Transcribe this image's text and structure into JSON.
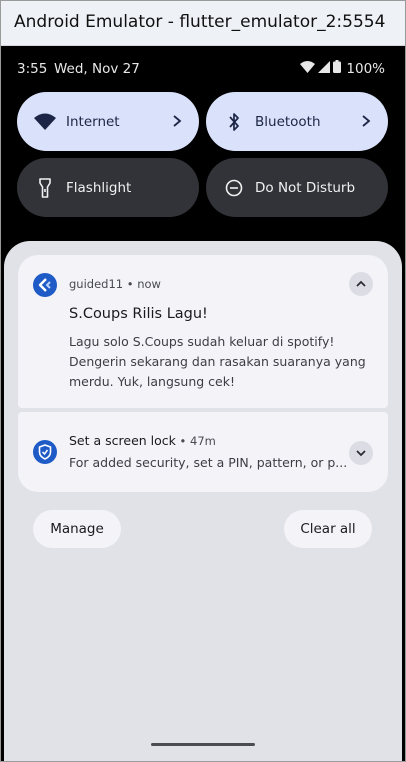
{
  "window": {
    "title": "Android Emulator - flutter_emulator_2:5554"
  },
  "status_bar": {
    "time": "3:55",
    "date": "Wed, Nov 27",
    "battery": "100%",
    "icons": [
      "wifi-icon",
      "cell-signal-icon",
      "battery-icon"
    ]
  },
  "quick_settings": {
    "tiles": [
      {
        "label": "Internet",
        "icon": "wifi-icon",
        "active": true,
        "has_chevron": true
      },
      {
        "label": "Bluetooth",
        "icon": "bluetooth-icon",
        "active": true,
        "has_chevron": true
      },
      {
        "label": "Flashlight",
        "icon": "flashlight-icon",
        "active": false
      },
      {
        "label": "Do Not Disturb",
        "icon": "do-not-disturb-icon",
        "active": false
      }
    ]
  },
  "notifications": [
    {
      "app": "guided11",
      "time": "now",
      "title": "S.Coups Rilis Lagu!",
      "body": "Lagu solo S.Coups sudah keluar di spotify! Dengerin sekarang dan rasakan suaranya yang merdu. Yuk, langsung cek!",
      "expanded": true
    },
    {
      "title": "Set a screen lock",
      "time": "47m",
      "body": "For added security, set a PIN, pattern, or p...",
      "expanded": false
    }
  ],
  "actions": {
    "manage": "Manage",
    "clear_all": "Clear all"
  },
  "colors": {
    "tile_active": "#d9e2fa",
    "tile_inactive": "#323338",
    "shade": "#e1e2e8",
    "card": "#f3f3f8",
    "accent": "#1e5bc6"
  }
}
